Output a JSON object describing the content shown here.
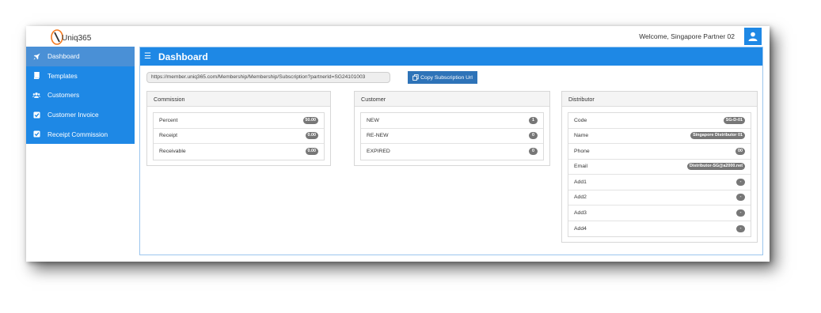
{
  "app": {
    "logo_text": "Uniq365",
    "welcome": "Welcome, Singapore Partner 02"
  },
  "colors": {
    "primary": "#1e88e5",
    "sidebar_active": "#4a90d6",
    "button": "#2e73b8",
    "logo_orange": "#f47b20",
    "badge": "#777777"
  },
  "sidebar": {
    "items": [
      {
        "label": "Dashboard",
        "icon": "rocket-icon"
      },
      {
        "label": "Templates",
        "icon": "book-icon"
      },
      {
        "label": "Customers",
        "icon": "users-icon"
      },
      {
        "label": "Customer Invoice",
        "icon": "checkbox-icon"
      },
      {
        "label": "Receipt Commission",
        "icon": "checkbox-icon"
      }
    ]
  },
  "main": {
    "title": "Dashboard",
    "url": "https://member.uniq365.com/Membership/Membership/Subscription?partnerId=SG24101003",
    "copy_button": "Copy Subscription Url"
  },
  "commission": {
    "title": "Commission",
    "rows": [
      {
        "label": "Percent",
        "value": "50.00"
      },
      {
        "label": "Receipt",
        "value": "0.00"
      },
      {
        "label": "Receivable",
        "value": "0.00"
      }
    ]
  },
  "customer": {
    "title": "Customer",
    "rows": [
      {
        "label": "NEW",
        "value": "1"
      },
      {
        "label": "RE-NEW",
        "value": "0"
      },
      {
        "label": "EXPIRED",
        "value": "0"
      }
    ]
  },
  "distributor": {
    "title": "Distributor",
    "rows": [
      {
        "label": "Code",
        "value": "SG-D-01"
      },
      {
        "label": "Name",
        "value": "Singapore Distributor 01"
      },
      {
        "label": "Phone",
        "value": "00"
      },
      {
        "label": "Email",
        "value": "Distributor-SG@a2000.net"
      },
      {
        "label": "Add1",
        "value": "-"
      },
      {
        "label": "Add2",
        "value": "-"
      },
      {
        "label": "Add3",
        "value": "-"
      },
      {
        "label": "Add4",
        "value": "-"
      }
    ]
  }
}
